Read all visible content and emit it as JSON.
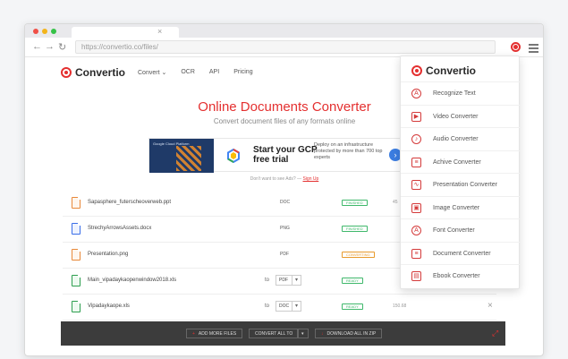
{
  "browser": {
    "url": "https://convertio.co/files/",
    "tab_close": "×",
    "nav": {
      "back": "←",
      "forward": "→",
      "reload": "↻"
    }
  },
  "site": {
    "logo_text": "Convertio",
    "nav_items": [
      "Convert ⌄",
      "OCR",
      "API",
      "Pricing"
    ]
  },
  "hero": {
    "title": "Online Documents Converter",
    "subtitle": "Convert document files of any formats online"
  },
  "ad": {
    "image_label": "Google Cloud Platform",
    "headline": "Start your GCP free trial",
    "body": "Deploy on an infrastructure protected by more than 700 top experts",
    "arrow": "›",
    "dont_want_text": "Don't want to see Ads?",
    "dont_want_sep": " — ",
    "dont_want_link": "Sign Up"
  },
  "files": [
    {
      "name": "Sapasphere_futerscheoverweb.ppt",
      "type": "ppt",
      "format": "DOC",
      "status": "finished",
      "status_color": "green",
      "size": "45",
      "has_select": false
    },
    {
      "name": "StrechyArrowsAssets.docx",
      "type": "docx",
      "format": "PNG",
      "status": "finished",
      "status_color": "green",
      "size": "",
      "has_select": false
    },
    {
      "name": "Presentation.png",
      "type": "png",
      "format": "PDF",
      "status": "converting",
      "status_color": "orange",
      "size": "",
      "has_select": false
    },
    {
      "name": "Main_vipadaykaopenwindow2018.xls",
      "type": "xls",
      "to": "to",
      "format": "PDF",
      "status": "ready",
      "status_color": "green",
      "size": "",
      "has_select": true
    },
    {
      "name": "Vipadaykaope.xls",
      "type": "xls",
      "to": "to",
      "format": "DOC",
      "status": "ready",
      "status_color": "green",
      "size": "150.68",
      "has_select": true
    }
  ],
  "row_close": "×",
  "row_caret": "▾",
  "actions": {
    "add_more": "Add more files",
    "convert_all": "Convert all to",
    "download_all": "Download all in zip",
    "plus": "+",
    "download_mark": "↓",
    "expand_icon": "⤢"
  },
  "dropdown": {
    "logo_text": "Convertio",
    "items": [
      {
        "label": "Recognize Text",
        "icon": "A",
        "shape": "round"
      },
      {
        "label": "Video Converter",
        "icon": "▶",
        "shape": "square"
      },
      {
        "label": "Audio Converter",
        "icon": "♪",
        "shape": "round"
      },
      {
        "label": "Achive Converter",
        "icon": "≡",
        "shape": "square"
      },
      {
        "label": "Presentation Converter",
        "icon": "∿",
        "shape": "square"
      },
      {
        "label": "Image Converter",
        "icon": "▣",
        "shape": "square"
      },
      {
        "label": "Font Converter",
        "icon": "A",
        "shape": "round"
      },
      {
        "label": "Document Converter",
        "icon": "≡",
        "shape": "square"
      },
      {
        "label": "Ebook Converter",
        "icon": "▤",
        "shape": "square"
      }
    ]
  },
  "colors": {
    "brand_red": "#e43030",
    "finished": "#3fb86b",
    "converting": "#e89a2c",
    "actionbar": "#3c3c3c"
  }
}
